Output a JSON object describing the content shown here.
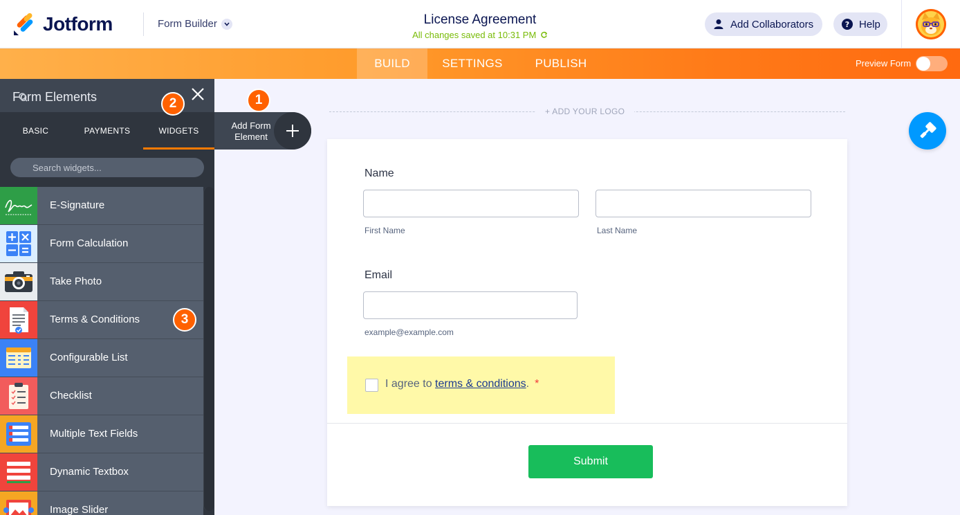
{
  "header": {
    "brand": "Jotform",
    "builder_switch": "Form Builder",
    "form_title": "License Agreement",
    "save_status": "All changes saved at 10:31 PM",
    "add_collaborators": "Add Collaborators",
    "help": "Help"
  },
  "nav": {
    "tabs": [
      {
        "label": "BUILD",
        "active": true
      },
      {
        "label": "SETTINGS",
        "active": false
      },
      {
        "label": "PUBLISH",
        "active": false
      }
    ],
    "preview_label": "Preview Form",
    "preview_on": false
  },
  "panel": {
    "title": "Form Elements",
    "tabs": [
      {
        "label": "BASIC",
        "active": false
      },
      {
        "label": "PAYMENTS",
        "active": false
      },
      {
        "label": "WIDGETS",
        "active": true
      }
    ],
    "search_placeholder": "Search widgets...",
    "widgets": [
      {
        "label": "E-Signature",
        "icon": "signature-icon",
        "thumb_color": "#2e9e47"
      },
      {
        "label": "Form Calculation",
        "icon": "calculator-icon",
        "thumb_color": "#dbeeff"
      },
      {
        "label": "Take Photo",
        "icon": "camera-icon",
        "thumb_color": "#e9ecef"
      },
      {
        "label": "Terms & Conditions",
        "icon": "document-check-icon",
        "thumb_color": "#f0443c"
      },
      {
        "label": "Configurable List",
        "icon": "grid-list-icon",
        "thumb_color": "#3b82f6"
      },
      {
        "label": "Checklist",
        "icon": "clipboard-icon",
        "thumb_color": "#f25c5c"
      },
      {
        "label": "Multiple Text Fields",
        "icon": "text-fields-icon",
        "thumb_color": "#f5a623"
      },
      {
        "label": "Dynamic Textbox",
        "icon": "textbox-icon",
        "thumb_color": "#f0443c"
      },
      {
        "label": "Image Slider",
        "icon": "image-slider-icon",
        "thumb_color": "#f5a623"
      }
    ]
  },
  "badges": {
    "one": "1",
    "two": "2",
    "three": "3"
  },
  "add_element": {
    "label": "Add Form Element"
  },
  "canvas": {
    "add_logo": "+ ADD YOUR LOGO"
  },
  "form": {
    "name_label": "Name",
    "first_name_sub": "First Name",
    "last_name_sub": "Last Name",
    "email_label": "Email",
    "email_sub": "example@example.com",
    "agree_prefix": "I agree to ",
    "agree_link": "terms & conditions",
    "agree_suffix": ".",
    "required_mark": "*",
    "submit": "Submit"
  },
  "colors": {
    "accent_orange": "#ff6100",
    "brand_navy": "#0a1551",
    "submit_green": "#18bd5b",
    "save_green": "#78bb07",
    "designer_blue": "#0099ff"
  }
}
